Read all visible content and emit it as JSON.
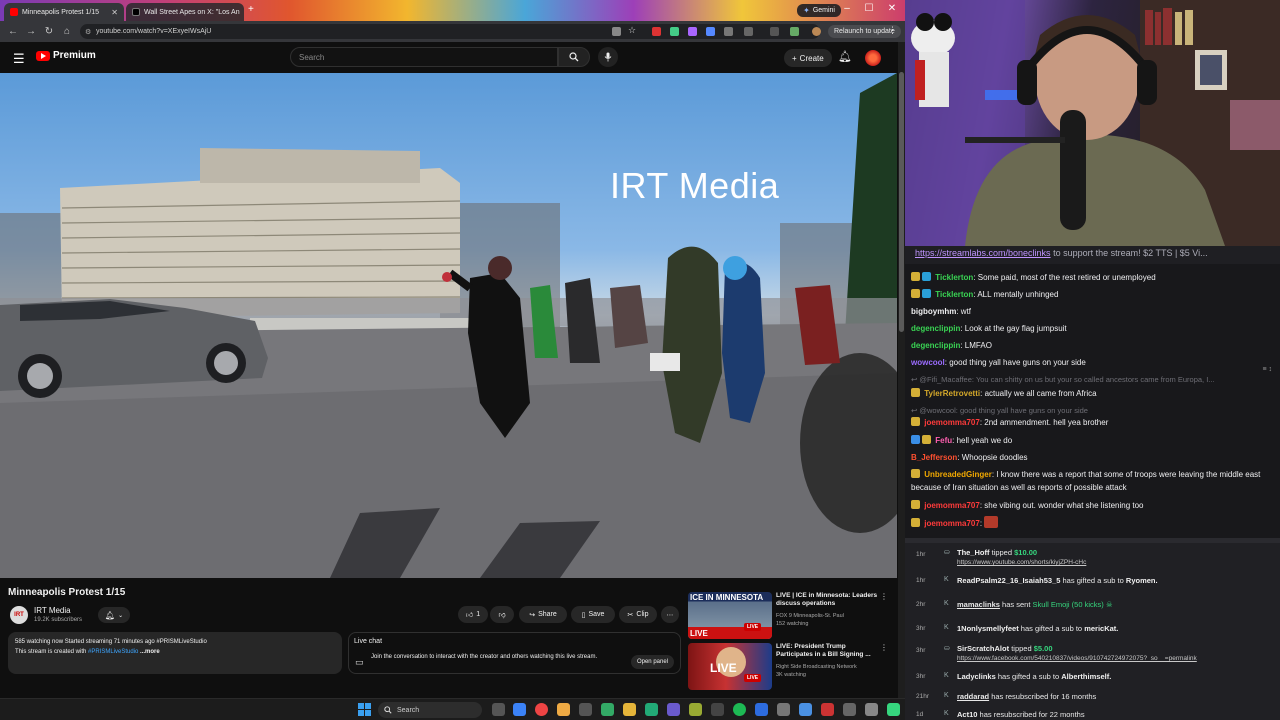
{
  "browser": {
    "tabs": [
      {
        "label": "Minneapolis Protest 1/15",
        "active": true
      },
      {
        "label": "Wall Street Apes on X: \"Los An",
        "active": false
      }
    ],
    "gemini_label": "Gemini",
    "url": "youtube.com/watch?v=XExyeIWsAjU",
    "relaunch_label": "Relaunch to update"
  },
  "youtube": {
    "logo_text": "Premium",
    "search_placeholder": "Search",
    "create_label": "Create",
    "video": {
      "overlay_text": "IRT Media",
      "title": "Minneapolis Protest 1/15",
      "channel": "IRT Media",
      "subscribers": "19.2K subscribers",
      "likes": "1",
      "share_label": "Share",
      "save_label": "Save",
      "clip_label": "Clip"
    },
    "description": {
      "line1": "585 watching now  Started streaming 71 minutes ago  #PRISMLiveStudio",
      "line2_prefix": "This stream is created with ",
      "line2_link": "#PRISMLiveStudio",
      "line2_more": " ...more"
    },
    "live_chat": {
      "title": "Live chat",
      "text": "Join the conversation to interact with the creator and others watching this live stream.",
      "open_label": "Open panel"
    },
    "recommendations": [
      {
        "thumb_label": "ICE IN MINNESOTA",
        "badge": "LIVE",
        "title": "LIVE | ICE in Minnesota: Leaders discuss operations",
        "channel": "FOX 9 Minneapolis-St. Paul",
        "meta": "152 watching"
      },
      {
        "thumb_label": "LIVE",
        "badge": "LIVE",
        "title": "LIVE: President Trump Participates in a Bill Signing ...",
        "channel": "Right Side Broadcasting Network",
        "meta": "3K watching"
      }
    ]
  },
  "stream_chat": {
    "pinned": "https://streamlabs.com/bonecliinks to support the stream! $2 TTS | $5 Vi...",
    "pinned_link": "https://streamlabs.com/boneclinks",
    "pinned_rest": " to support the stream! $2 TTS | $5 Vi...",
    "messages": [
      {
        "user": "Ticklerton",
        "color": "#39d353",
        "text": "Some paid, most of the rest retired or unemployed"
      },
      {
        "user": "Ticklerton",
        "color": "#39d353",
        "text": "ALL mentally unhinged"
      },
      {
        "user": "bigboymhm",
        "color": "#efeff1",
        "text": "wtf"
      },
      {
        "user": "degenclippin",
        "color": "#39d353",
        "text": "Look at the gay flag jumpsuit"
      },
      {
        "user": "degenclippin",
        "color": "#39d353",
        "text": "LMFAO"
      },
      {
        "user": "wowcool",
        "color": "#9b6cff",
        "text": "good thing yall have guns on your side"
      },
      {
        "user": "@Fifi_Macaffee",
        "color": "#6e6e75",
        "text": "You can shitty on us but your so called ancestors came from Europa, I..."
      },
      {
        "user": "TylerRetrovetti",
        "color": "#d4a82a",
        "text": "actually we all came from Africa"
      },
      {
        "user": "@wowcool",
        "color": "#6e6e75",
        "text": "good thing yall have guns on your side"
      },
      {
        "user": "joemomma707",
        "color": "#ff3b3b",
        "text": "2nd ammendment. hell yea brother"
      },
      {
        "user": "Fefu",
        "color": "#ff5fb0",
        "text": "hell yeah we do"
      },
      {
        "user": "B_Jefferson",
        "color": "#ff5030",
        "text": "Whoopsie doodles"
      },
      {
        "user": "UnbreadedGinger",
        "color": "#f2a900",
        "text": "I know there was a report that some of troops were leaving the middle east because of Iran situation as well as reports of possible attack"
      },
      {
        "user": "joemomma707",
        "color": "#ff3b3b",
        "text": "she vibing out. wonder what she listening too"
      },
      {
        "user": "joemomma707",
        "color": "#ff3b3b",
        "text": ""
      }
    ]
  },
  "events": [
    {
      "time": "1hr",
      "user": "The_Hoff",
      "action": "tipped",
      "amount": "$10.00",
      "link": "https://www.youtube.com/shorts/kiyjZPH-cHc"
    },
    {
      "time": "1hr",
      "user": "ReadPsalm22_16_Isaiah53_5",
      "text": "has gifted a sub to",
      "target": "Ryomen."
    },
    {
      "time": "2hr",
      "user": "mamaclinks",
      "text": "has sent",
      "extra": "Skull Emoji (50 kicks)"
    },
    {
      "time": "3hr",
      "user": "1Nonlysmellyfeet",
      "text": "has gifted a sub to",
      "target": "mericKat."
    },
    {
      "time": "3hr",
      "user": "SirScratchAlot",
      "action": "tipped",
      "amount": "$5.00",
      "link": "https://www.facebook.com/540210837/videos/910742724972075?_so__=permalink"
    },
    {
      "time": "3hr",
      "user": "Ladyclinks",
      "text": "has gifted a sub to",
      "target": "Alberthimself."
    },
    {
      "time": "21hr",
      "user": "raddarad",
      "text": "has resubscribed for 16 months"
    },
    {
      "time": "1d",
      "user": "Act10",
      "text": "has resubscribed for 22 months"
    }
  ],
  "taskbar": {
    "search_label": "Search"
  },
  "colors": {
    "youtube_red": "#ff0000",
    "kick_green": "#36d67e",
    "link_blue": "#3ea6ff"
  }
}
